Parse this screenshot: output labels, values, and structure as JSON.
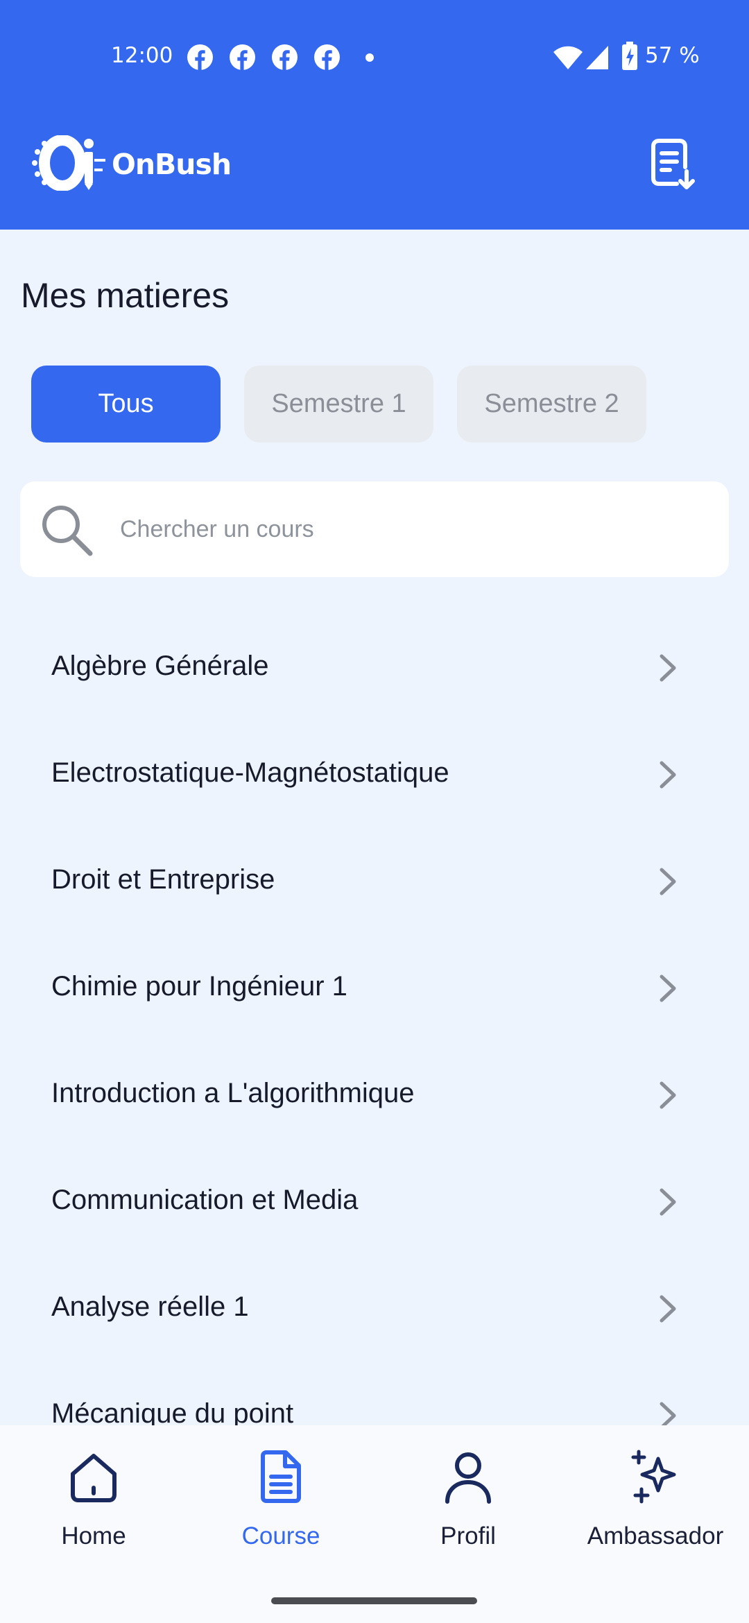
{
  "status_bar": {
    "time": "12:00",
    "battery": "57 %",
    "notification_icons": [
      "facebook-icon",
      "facebook-icon",
      "facebook-icon",
      "facebook-icon"
    ]
  },
  "app_bar": {
    "logo_text": "OnBush",
    "action_icon": "document-download-icon"
  },
  "page": {
    "title": "Mes matieres"
  },
  "filters": [
    {
      "label": "Tous",
      "active": true
    },
    {
      "label": "Semestre 1",
      "active": false
    },
    {
      "label": "Semestre 2",
      "active": false
    }
  ],
  "search": {
    "placeholder": "Chercher un cours",
    "value": ""
  },
  "courses": [
    "Algèbre Générale",
    "Electrostatique-Magnétostatique",
    "Droit et Entreprise",
    "Chimie pour Ingénieur 1",
    "Introduction a L'algorithmique",
    "Communication et Media",
    "Analyse réelle 1",
    "Mécanique du point"
  ],
  "bottom_nav": {
    "items": [
      {
        "label": "Home",
        "icon": "home-icon",
        "active": false
      },
      {
        "label": "Course",
        "icon": "document-icon",
        "active": true
      },
      {
        "label": "Profil",
        "icon": "user-icon",
        "active": false
      },
      {
        "label": "Ambassador",
        "icon": "sparkles-icon",
        "active": false
      }
    ]
  },
  "colors": {
    "primary": "#3468ef",
    "background": "#eef4fe",
    "text": "#161a2b",
    "inactive_tab": "#e8ebf0"
  }
}
